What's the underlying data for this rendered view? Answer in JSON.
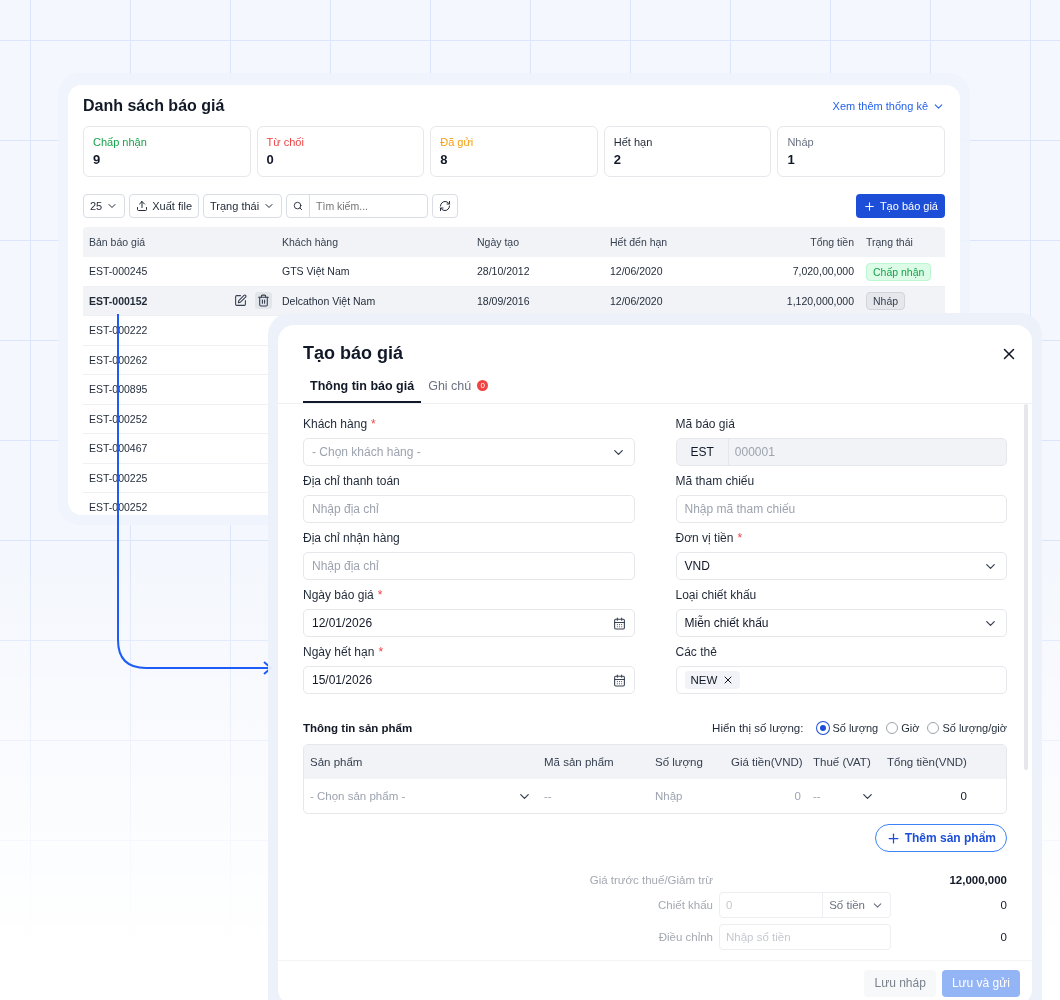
{
  "quote_list": {
    "title": "Danh sách báo giá",
    "stats_link": "Xem thêm thống kê",
    "stats": [
      {
        "label": "Chấp nhận",
        "value": "9",
        "color": "#16a34a"
      },
      {
        "label": "Từ chối",
        "value": "0",
        "color": "#ef4444"
      },
      {
        "label": "Đã gửi",
        "value": "8",
        "color": "#f59e0b"
      },
      {
        "label": "Hết hạn",
        "value": "2",
        "color": "#1f2937"
      },
      {
        "label": "Nháp",
        "value": "1",
        "color": "#6b7280"
      }
    ],
    "toolbar": {
      "page_size": "25",
      "export": "Xuất file",
      "status_filter": "Trạng thái",
      "search_placeholder": "Tìm kiếm...",
      "create": "Tạo báo giá"
    },
    "columns": [
      "Bản báo giá",
      "Khách hàng",
      "Ngày tạo",
      "Hết đến hạn",
      "Tổng tiền",
      "Trạng thái"
    ],
    "rows": [
      {
        "id": "EST-000245",
        "customer": "GTS Việt Nam",
        "created": "28/10/2012",
        "due": "12/06/2020",
        "total": "7,020,00,000",
        "status": {
          "label": "Chấp nhận",
          "kind": "accepted"
        },
        "selected": false
      },
      {
        "id": "EST-000152",
        "customer": "Delcathon Việt Nam",
        "created": "18/09/2016",
        "due": "12/06/2020",
        "total": "1,120,000,000",
        "status": {
          "label": "Nháp",
          "kind": "draft"
        },
        "selected": true
      },
      {
        "id": "EST-000222",
        "selected": false
      },
      {
        "id": "EST-000262",
        "selected": false
      },
      {
        "id": "EST-000895",
        "selected": false
      },
      {
        "id": "EST-000252",
        "selected": false
      },
      {
        "id": "EST-000467",
        "selected": false
      },
      {
        "id": "EST-000225",
        "selected": false
      },
      {
        "id": "EST-000252",
        "selected": false
      }
    ]
  },
  "create_dialog": {
    "title": "Tạo báo giá",
    "required_mark": "*",
    "tabs": [
      {
        "label": "Thông tin báo giá",
        "selected": true
      },
      {
        "label": "Ghi chú",
        "selected": false,
        "badge": "0"
      }
    ],
    "fields": [
      {
        "kind": "select",
        "label": "Khách hàng",
        "required": true,
        "placeholder": "- Chọn khách hàng -"
      },
      {
        "kind": "code",
        "label": "Mã báo giá",
        "required": false,
        "prefix": "EST",
        "placeholder": "000001",
        "disabled": true
      },
      {
        "kind": "text",
        "label": "Địa chỉ thanh toán",
        "required": false,
        "placeholder": "Nhập địa chỉ"
      },
      {
        "kind": "text",
        "label": "Mã tham chiếu",
        "required": false,
        "placeholder": "Nhập mã tham chiếu"
      },
      {
        "kind": "text",
        "label": "Địa chỉ nhận hàng",
        "required": false,
        "placeholder": "Nhập địa chỉ"
      },
      {
        "kind": "select",
        "label": "Đơn vị tiền",
        "required": true,
        "value": "VND"
      },
      {
        "kind": "date",
        "label": "Ngày báo giá",
        "required": true,
        "value": "12/01/2026"
      },
      {
        "kind": "select",
        "label": "Loại chiết khấu",
        "required": false,
        "value": "Miễn chiết khấu"
      },
      {
        "kind": "date",
        "label": "Ngày hết hạn",
        "required": true,
        "value": "15/01/2026"
      },
      {
        "kind": "tags",
        "label": "Các thẻ",
        "required": false,
        "tags": [
          "NEW"
        ]
      }
    ],
    "products": {
      "title": "Thông tin sản phẩm",
      "quantity_label": "Hiển thị số lượng:",
      "quantity_options": [
        {
          "label": "Số lượng",
          "selected": true
        },
        {
          "label": "Giờ",
          "selected": false
        },
        {
          "label": "Số lượng/giờ",
          "selected": false
        }
      ],
      "columns": [
        "Sản phẩm",
        "Mã sản phẩm",
        "Số lượng",
        "Giá tiền(VND)",
        "Thuế (VAT)",
        "Tổng tiền(VND)"
      ],
      "row": {
        "product_placeholder": "- Chọn sản phẩm -",
        "code": "--",
        "quantity_placeholder": "Nhập",
        "price": "0",
        "tax": "--",
        "total": "0"
      },
      "add_button": "Thêm sản phẩm"
    },
    "summary": {
      "subtotal_label": "Giá trước thuế/Giảm trừ",
      "subtotal": "12,000,000",
      "discount_label": "Chiết khấu",
      "discount_placeholder": "0",
      "discount_unit": "Số tiền",
      "discount_value": "0",
      "adjust_label": "Điều chỉnh",
      "adjust_placeholder": "Nhập số tiền",
      "adjust_value": "0"
    },
    "buttons": [
      {
        "label": "Lưu nháp",
        "kind": "secondary",
        "disabled": true
      },
      {
        "label": "Lưu và gửi",
        "kind": "primary",
        "disabled": true
      }
    ]
  }
}
